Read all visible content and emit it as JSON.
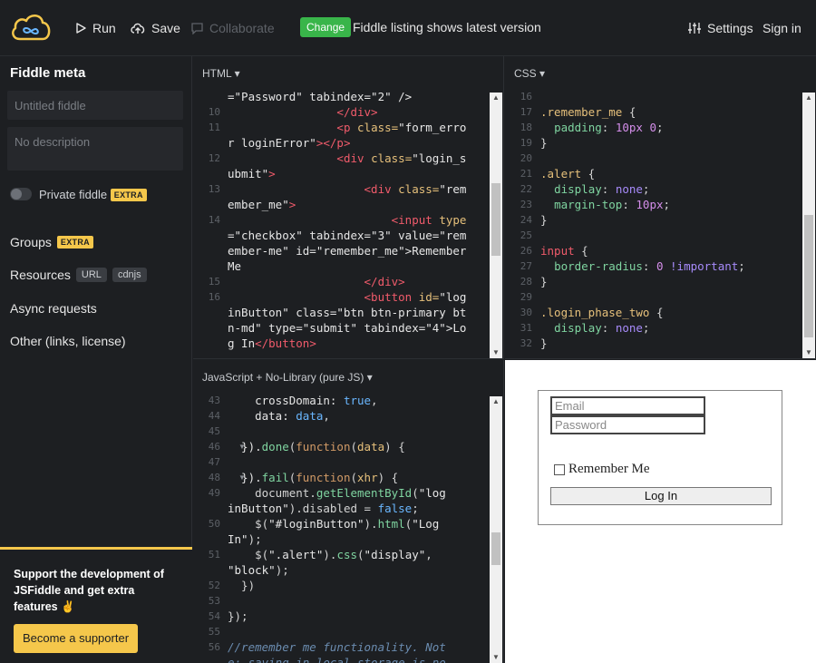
{
  "topbar": {
    "run_label": "Run",
    "save_label": "Save",
    "collaborate_label": "Collaborate",
    "change_badge": "Change",
    "change_message": "Fiddle listing shows latest version",
    "settings_label": "Settings",
    "signin_label": "Sign in"
  },
  "sidebar": {
    "title": "Fiddle meta",
    "title_placeholder": "Untitled fiddle",
    "description_placeholder": "No description",
    "private_label": "Private fiddle",
    "extra_badge": "EXTRA",
    "groups_label": "Groups",
    "groups_badge": "EXTRA",
    "resources_label": "Resources",
    "resources_chips": [
      "URL",
      "cdnjs"
    ],
    "async_label": "Async requests",
    "other_label": "Other (links, license)",
    "support_text": "Support the development of JSFiddle and get extra features ✌",
    "support_button": "Become a supporter"
  },
  "panels": {
    "html_header": "HTML",
    "css_header": "CSS",
    "js_header": "JavaScript + No-Library (pure JS)"
  },
  "html_lines": [
    "",
    "10",
    "11",
    "",
    "12",
    "",
    "13",
    "",
    "14",
    "",
    "",
    "",
    "15",
    "16",
    "",
    "",
    ""
  ],
  "css_lines": [
    "16",
    "17",
    "18",
    "19",
    "20",
    "21",
    "22",
    "23",
    "24",
    "25",
    "26",
    "27",
    "28",
    "29",
    "30",
    "31",
    "32"
  ],
  "js_lines": [
    "43",
    "44",
    "45",
    "46",
    "47",
    "48",
    "49",
    "",
    "50",
    "",
    "51",
    "",
    "52",
    "53",
    "54",
    "55",
    "56",
    ""
  ],
  "result": {
    "email_placeholder": "Email",
    "password_placeholder": "Password",
    "remember_label": "Remember Me",
    "login_button": "Log In"
  },
  "colors": {
    "accent_yellow": "#f5c74b",
    "change_green": "#39b54a",
    "bg_dark": "#1d1f22"
  }
}
